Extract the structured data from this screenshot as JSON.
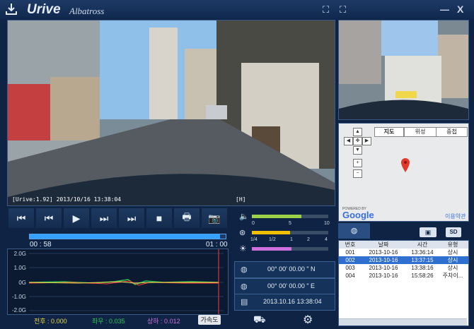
{
  "app": {
    "brand": "Urive",
    "subtitle": "Albatross"
  },
  "titlebar": {
    "expand1": "⛶",
    "expand2": "⛶",
    "minimize": "—",
    "close": "X"
  },
  "video": {
    "osd_left": "[Urive:1.92]  2013/10/16  13:38:04",
    "osd_right": "[H]"
  },
  "controls": {
    "prev_end": "⏮",
    "prev": "⏮",
    "play": "▶",
    "next": "⏭",
    "next_end": "⏭",
    "stop": "■",
    "print": "🖶",
    "camera": "📷"
  },
  "timeline": {
    "current": "00 : 58",
    "total": "01 : 00",
    "progress": 0.97
  },
  "graph": {
    "yticks": [
      "2.0G",
      "1.0G",
      "0G",
      "-1.0G",
      "-2.0G"
    ],
    "front_back": "전후 : 0.000",
    "left_right": "좌우 : 0.035",
    "up_down": "상하 : 0.012",
    "accel_button": "가속도"
  },
  "levels": {
    "volume": {
      "scale": [
        "0",
        "5",
        "10"
      ],
      "value": 0.65
    },
    "speed": {
      "scale": [
        "1/4",
        "1/2",
        "1",
        "2",
        "4"
      ],
      "value": 0.5
    },
    "brightness": {
      "value": 0.52
    }
  },
  "gps": {
    "lat": "00° 00'   00.00 \"  N",
    "lon": "00° 00'   00.00 \"  E",
    "datetime": "2013.10.16    13:38:04"
  },
  "map": {
    "tabs": [
      "지도",
      "위성",
      "중첩"
    ],
    "powered": "POWERED BY",
    "google": "Google",
    "terms": "이용약관"
  },
  "list": {
    "headers": [
      "번호",
      "날짜",
      "시간",
      "유형"
    ],
    "rows": [
      {
        "no": "001",
        "date": "2013-10-16",
        "time": "13:36:14",
        "type": "상시"
      },
      {
        "no": "002",
        "date": "2013-10-16",
        "time": "13:37:15",
        "type": "상시"
      },
      {
        "no": "003",
        "date": "2013-10-16",
        "time": "13:38:16",
        "type": "상시"
      },
      {
        "no": "004",
        "date": "2013-10-16",
        "time": "15:58:26",
        "type": "주차이..."
      }
    ]
  },
  "colors": {
    "accent": "#34a0ff",
    "selected_row": "#2f6fd0",
    "volume": "#9bd24a",
    "speed": "#f0c000",
    "brightness": "#d070e0",
    "green_line": "#31c553",
    "red_line": "#ff3b3b",
    "yellow_line": "#e7d84a"
  }
}
